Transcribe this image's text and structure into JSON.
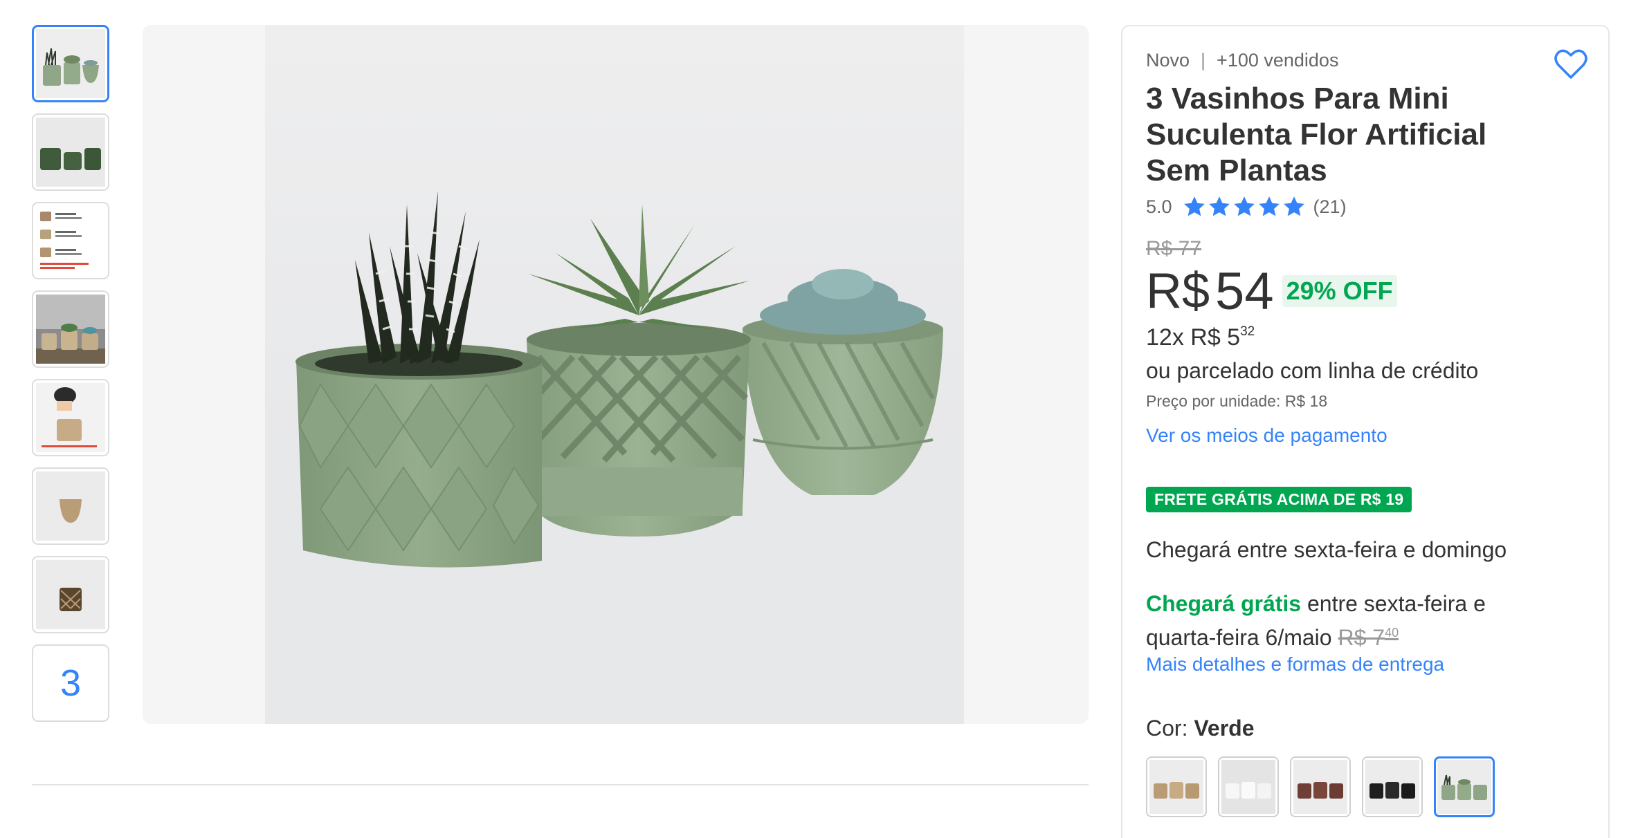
{
  "thumbnails": {
    "count_label": "3"
  },
  "product": {
    "condition": "Novo",
    "separator": "|",
    "sold": "+100 vendidos",
    "title": "3 Vasinhos Para Mini Suculenta Flor Artificial Sem Plantas",
    "rating": "5.0",
    "rating_stars": 5,
    "reviews": "(21)",
    "old_price": "R$ 77",
    "currency": "R$",
    "price": "54",
    "discount": "29% OFF",
    "installments_prefix": "12x R$ 5",
    "installments_cents": "32",
    "credit_text": "ou parcelado com linha de crédito",
    "unit_price": "Preço por unidade: R$ 18",
    "payment_link": "Ver os meios de pagamento"
  },
  "shipping": {
    "badge": "FRETE GRÁTIS ACIMA DE R$ 19",
    "arrives": "Chegará entre sexta-feira e domingo",
    "free_label": "Chegará grátis",
    "free_text": " entre sexta-feira e quarta-feira 6/maio ",
    "old_shipping": "R$ 7",
    "old_shipping_cents": "40",
    "details_link": "Mais detalhes e formas de entrega"
  },
  "color": {
    "label": "Cor: ",
    "selected": "Verde"
  },
  "colors_theme": {
    "accent": "#3483fa",
    "green": "#00a650",
    "pot_green": "#8fa787"
  }
}
